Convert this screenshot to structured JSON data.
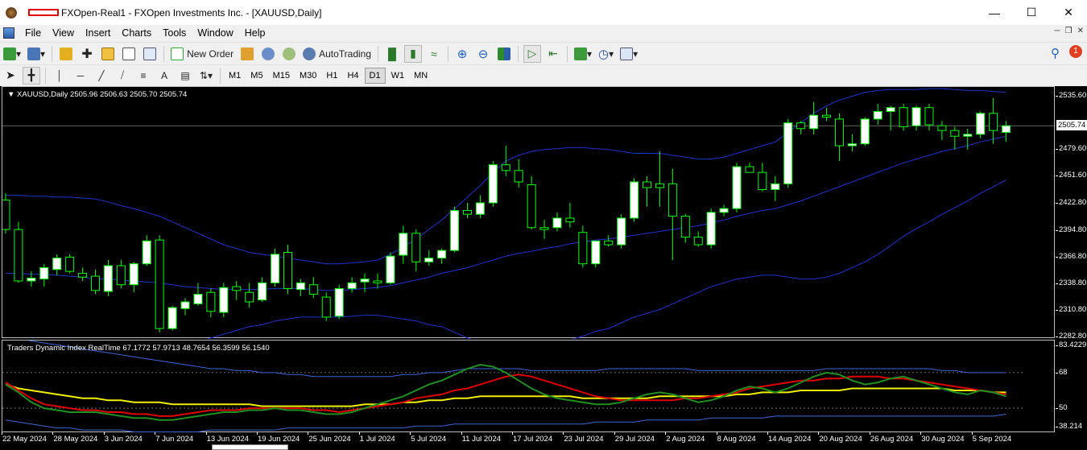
{
  "window": {
    "title": "FXOpen-Real1 - FXOpen Investments Inc. - [XAUUSD,Daily]",
    "minimize_icon": "minimize-icon",
    "maximize_icon": "maximize-icon",
    "close_icon": "close-icon"
  },
  "menu": [
    "File",
    "View",
    "Insert",
    "Charts",
    "Tools",
    "Window",
    "Help"
  ],
  "toolbar": {
    "new_order_label": "New Order",
    "autotrading_label": "AutoTrading",
    "notification_count": "1"
  },
  "timeframes": [
    "M1",
    "M5",
    "M15",
    "M30",
    "H1",
    "H4",
    "D1",
    "W1",
    "MN"
  ],
  "active_timeframe": "D1",
  "chart": {
    "header": "XAUUSD,Daily  2505.96 2506.63 2505.70 2505.74",
    "current_price": "2505.74",
    "colors": {
      "background": "#000000",
      "bull": "#00ff00",
      "bands": "#1e32d2",
      "candle_fill_up": "#ffffff",
      "candle_fill_down": "#000000"
    },
    "y_labels": [
      "2535.60",
      "2479.60",
      "2451.60",
      "2422.80",
      "2394.80",
      "2366.80",
      "2338.80",
      "2310.80",
      "2282.80"
    ],
    "x_labels": [
      "22 May 2024",
      "28 May 2024",
      "3 Jun 2024",
      "7 Jun 2024",
      "13 Jun 2024",
      "19 Jun 2024",
      "25 Jun 2024",
      "1 Jul 2024",
      "5 Jul 2024",
      "11 Jul 2024",
      "17 Jul 2024",
      "23 Jul 2024",
      "29 Jul 2024",
      "2 Aug 2024",
      "8 Aug 2024",
      "14 Aug 2024",
      "20 Aug 2024",
      "26 Aug 2024",
      "30 Aug 2024",
      "5 Sep 2024"
    ]
  },
  "indicator": {
    "header": "Traders Dynamic Index RealTime 67.1772 57.9713 48.7654 56.3599 56.1540",
    "y_labels": [
      "83.4229",
      "68",
      "50",
      "38.214"
    ]
  },
  "chart_data": {
    "type": "candlestick",
    "symbol": "XAUUSD",
    "timeframe": "Daily",
    "ylim": [
      2282.8,
      2535.6
    ],
    "candles": [
      [
        2427,
        2434,
        2392,
        2396
      ],
      [
        2396,
        2404,
        2340,
        2342
      ],
      [
        2342,
        2352,
        2336,
        2345
      ],
      [
        2344,
        2360,
        2336,
        2356
      ],
      [
        2354,
        2370,
        2348,
        2366
      ],
      [
        2367,
        2370,
        2350,
        2352
      ],
      [
        2350,
        2356,
        2342,
        2346
      ],
      [
        2347,
        2354,
        2328,
        2332
      ],
      [
        2331,
        2364,
        2326,
        2358
      ],
      [
        2358,
        2364,
        2334,
        2338
      ],
      [
        2338,
        2362,
        2330,
        2360
      ],
      [
        2360,
        2390,
        2358,
        2384
      ],
      [
        2385,
        2390,
        2288,
        2292
      ],
      [
        2292,
        2316,
        2290,
        2314
      ],
      [
        2313,
        2324,
        2306,
        2320
      ],
      [
        2318,
        2340,
        2316,
        2328
      ],
      [
        2330,
        2334,
        2304,
        2310
      ],
      [
        2309,
        2340,
        2304,
        2335
      ],
      [
        2336,
        2342,
        2322,
        2332
      ],
      [
        2330,
        2340,
        2314,
        2320
      ],
      [
        2322,
        2346,
        2320,
        2340
      ],
      [
        2340,
        2376,
        2336,
        2370
      ],
      [
        2372,
        2380,
        2328,
        2334
      ],
      [
        2333,
        2344,
        2326,
        2340
      ],
      [
        2338,
        2346,
        2324,
        2328
      ],
      [
        2325,
        2330,
        2300,
        2304
      ],
      [
        2305,
        2338,
        2302,
        2334
      ],
      [
        2334,
        2346,
        2330,
        2340
      ],
      [
        2341,
        2350,
        2330,
        2344
      ],
      [
        2342,
        2350,
        2334,
        2340
      ],
      [
        2340,
        2372,
        2338,
        2368
      ],
      [
        2369,
        2400,
        2360,
        2392
      ],
      [
        2392,
        2396,
        2352,
        2362
      ],
      [
        2362,
        2374,
        2358,
        2366
      ],
      [
        2366,
        2376,
        2360,
        2374
      ],
      [
        2374,
        2420,
        2372,
        2416
      ],
      [
        2416,
        2424,
        2408,
        2412
      ],
      [
        2412,
        2432,
        2408,
        2424
      ],
      [
        2424,
        2468,
        2420,
        2464
      ],
      [
        2464,
        2484,
        2452,
        2458
      ],
      [
        2458,
        2470,
        2440,
        2446
      ],
      [
        2443,
        2452,
        2396,
        2398
      ],
      [
        2398,
        2406,
        2386,
        2396
      ],
      [
        2398,
        2414,
        2394,
        2408
      ],
      [
        2408,
        2424,
        2398,
        2404
      ],
      [
        2393,
        2400,
        2356,
        2360
      ],
      [
        2360,
        2380,
        2356,
        2384
      ],
      [
        2384,
        2390,
        2378,
        2380
      ],
      [
        2380,
        2412,
        2376,
        2408
      ],
      [
        2408,
        2450,
        2404,
        2446
      ],
      [
        2446,
        2452,
        2420,
        2440
      ],
      [
        2444,
        2478,
        2420,
        2440
      ],
      [
        2444,
        2460,
        2364,
        2410
      ],
      [
        2410,
        2412,
        2382,
        2388
      ],
      [
        2388,
        2394,
        2378,
        2380
      ],
      [
        2380,
        2418,
        2376,
        2414
      ],
      [
        2414,
        2422,
        2410,
        2418
      ],
      [
        2418,
        2466,
        2414,
        2462
      ],
      [
        2462,
        2466,
        2456,
        2456
      ],
      [
        2456,
        2466,
        2436,
        2438
      ],
      [
        2438,
        2452,
        2426,
        2444
      ],
      [
        2444,
        2512,
        2440,
        2508
      ],
      [
        2508,
        2510,
        2496,
        2502
      ],
      [
        2502,
        2530,
        2496,
        2516
      ],
      [
        2516,
        2524,
        2510,
        2514
      ],
      [
        2512,
        2518,
        2468,
        2484
      ],
      [
        2484,
        2496,
        2478,
        2486
      ],
      [
        2486,
        2514,
        2484,
        2512
      ],
      [
        2512,
        2528,
        2506,
        2520
      ],
      [
        2520,
        2526,
        2500,
        2524
      ],
      [
        2524,
        2528,
        2500,
        2504
      ],
      [
        2505,
        2526,
        2500,
        2524
      ],
      [
        2524,
        2528,
        2500,
        2506
      ],
      [
        2505,
        2510,
        2490,
        2500
      ],
      [
        2500,
        2504,
        2480,
        2494
      ],
      [
        2494,
        2502,
        2480,
        2496
      ],
      [
        2496,
        2520,
        2492,
        2518
      ],
      [
        2518,
        2534,
        2486,
        2500
      ],
      [
        2498,
        2510,
        2488,
        2505
      ]
    ],
    "bollinger": {
      "middle": [
        2350,
        2350,
        2349,
        2349,
        2348,
        2347,
        2346,
        2344,
        2344,
        2343,
        2342,
        2341,
        2340,
        2338,
        2336,
        2335,
        2334,
        2333,
        2333,
        2333,
        2333,
        2334,
        2334,
        2334,
        2333,
        2332,
        2332,
        2333,
        2334,
        2335,
        2337,
        2340,
        2343,
        2346,
        2350,
        2353,
        2356,
        2360,
        2364,
        2368,
        2371,
        2373,
        2376,
        2378,
        2381,
        2383,
        2385,
        2386,
        2388,
        2390,
        2392,
        2394,
        2396,
        2398,
        2400,
        2403,
        2406,
        2410,
        2413,
        2416,
        2418,
        2422,
        2426,
        2431,
        2436,
        2441,
        2446,
        2451,
        2456,
        2461,
        2466,
        2470,
        2474,
        2478,
        2481,
        2484,
        2488,
        2491,
        2494
      ],
      "upper": [
        2432,
        2432,
        2431,
        2431,
        2430,
        2430,
        2429,
        2428,
        2425,
        2421,
        2418,
        2414,
        2410,
        2404,
        2398,
        2392,
        2386,
        2380,
        2376,
        2372,
        2370,
        2368,
        2366,
        2364,
        2362,
        2360,
        2360,
        2361,
        2362,
        2364,
        2370,
        2378,
        2386,
        2396,
        2406,
        2418,
        2430,
        2442,
        2456,
        2468,
        2474,
        2478,
        2480,
        2481,
        2482,
        2482,
        2481,
        2480,
        2478,
        2476,
        2476,
        2476,
        2474,
        2472,
        2470,
        2470,
        2472,
        2476,
        2480,
        2484,
        2488,
        2498,
        2508,
        2518,
        2526,
        2532,
        2536,
        2540,
        2542,
        2543,
        2543,
        2543,
        2544,
        2544,
        2543,
        2542,
        2542,
        2541,
        2540
      ],
      "lower": [
        2268,
        2268,
        2267,
        2267,
        2266,
        2264,
        2263,
        2260,
        2263,
        2265,
        2266,
        2268,
        2270,
        2272,
        2274,
        2278,
        2282,
        2286,
        2290,
        2294,
        2296,
        2300,
        2302,
        2304,
        2304,
        2304,
        2304,
        2305,
        2306,
        2306,
        2304,
        2302,
        2300,
        2296,
        2294,
        2288,
        2282,
        2278,
        2272,
        2268,
        2268,
        2268,
        2272,
        2275,
        2280,
        2284,
        2289,
        2292,
        2298,
        2304,
        2308,
        2312,
        2318,
        2324,
        2330,
        2336,
        2340,
        2344,
        2346,
        2348,
        2348,
        2346,
        2344,
        2344,
        2346,
        2350,
        2356,
        2362,
        2370,
        2379,
        2389,
        2397,
        2404,
        2412,
        2419,
        2426,
        2434,
        2441,
        2448
      ]
    },
    "tdi": {
      "upper_band": [
        88,
        86,
        84,
        83,
        82,
        81,
        80,
        79,
        78,
        77,
        76,
        75,
        74,
        73,
        72,
        71,
        70,
        70,
        69,
        69,
        68,
        68,
        67,
        67,
        66,
        66,
        66,
        66,
        66,
        66,
        66,
        67,
        67,
        68,
        68,
        69,
        70,
        70,
        70,
        70,
        70,
        69,
        69,
        69,
        69,
        69,
        69,
        70,
        70,
        70,
        70,
        70,
        70,
        70,
        69,
        69,
        69,
        69,
        69,
        69,
        69,
        69,
        69,
        69,
        70,
        70,
        70,
        70,
        70,
        70,
        70,
        70,
        70,
        69,
        69,
        68,
        68,
        68,
        68
      ],
      "rsi_price": [
        63,
        59,
        55,
        52,
        51,
        50,
        49,
        49,
        48,
        48,
        47,
        47,
        46,
        46,
        47,
        48,
        49,
        49,
        49,
        50,
        50,
        50,
        50,
        50,
        49,
        49,
        48,
        49,
        50,
        51,
        52,
        53,
        55,
        56,
        57,
        59,
        60,
        62,
        64,
        66,
        67,
        66,
        64,
        62,
        60,
        58,
        56,
        55,
        54,
        54,
        54,
        54,
        54,
        55,
        55,
        56,
        57,
        58,
        60,
        61,
        62,
        63,
        64,
        64,
        65,
        65,
        66,
        66,
        66,
        65,
        65,
        64,
        63,
        62,
        61,
        60,
        59,
        58,
        57
      ],
      "signal": [
        62,
        60,
        59,
        58,
        57,
        56,
        55,
        55,
        54,
        54,
        53,
        53,
        53,
        52,
        52,
        52,
        52,
        52,
        52,
        52,
        51,
        51,
        51,
        51,
        51,
        51,
        51,
        51,
        52,
        52,
        52,
        53,
        53,
        54,
        54,
        55,
        55,
        56,
        56,
        56,
        56,
        56,
        56,
        56,
        56,
        55,
        55,
        55,
        55,
        55,
        55,
        56,
        56,
        56,
        56,
        56,
        56,
        57,
        57,
        58,
        58,
        58,
        59,
        59,
        59,
        59,
        60,
        60,
        60,
        60,
        60,
        60,
        60,
        60,
        59,
        59,
        59,
        58,
        58
      ],
      "rsi": [
        62,
        58,
        53,
        50,
        49,
        48,
        48,
        48,
        47,
        46,
        45,
        45,
        44,
        44,
        45,
        46,
        47,
        48,
        48,
        49,
        49,
        50,
        49,
        49,
        48,
        47,
        47,
        48,
        50,
        52,
        54,
        56,
        59,
        62,
        64,
        67,
        70,
        72,
        71,
        68,
        64,
        60,
        57,
        55,
        54,
        53,
        52,
        52,
        53,
        55,
        57,
        58,
        57,
        55,
        53,
        54,
        56,
        59,
        61,
        60,
        58,
        60,
        63,
        66,
        68,
        67,
        64,
        62,
        63,
        65,
        66,
        64,
        62,
        60,
        58,
        57,
        59,
        58,
        56
      ],
      "lower_band": [
        44,
        43,
        42,
        41,
        40,
        40,
        39,
        39,
        39,
        39,
        38,
        38,
        38,
        38,
        38,
        38,
        39,
        39,
        39,
        39,
        39,
        39,
        40,
        40,
        40,
        40,
        40,
        40,
        40,
        40,
        40,
        40,
        41,
        41,
        41,
        42,
        42,
        42,
        42,
        42,
        42,
        42,
        42,
        42,
        42,
        42,
        43,
        43,
        43,
        43,
        44,
        44,
        44,
        44,
        44,
        45,
        45,
        45,
        45,
        45,
        46,
        46,
        46,
        46,
        46,
        46,
        46,
        46,
        46,
        46,
        46,
        46,
        46,
        46,
        46,
        46,
        46,
        46,
        47
      ],
      "levels": [
        68,
        50
      ],
      "ylim": [
        38.214,
        83.4229
      ]
    }
  }
}
